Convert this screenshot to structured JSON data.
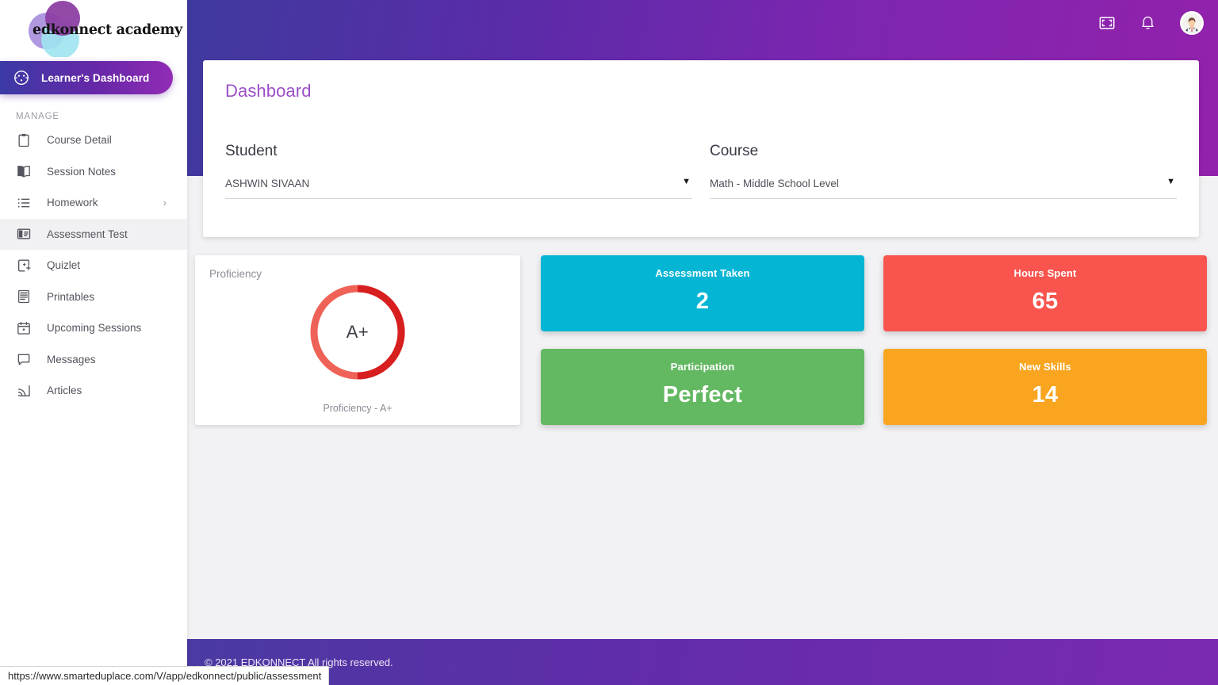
{
  "brand": {
    "name": "edkonnect academy",
    "logo_circle_colors": [
      "#8c3fa3",
      "#a88fdd",
      "#9fe4ef"
    ]
  },
  "sidebar": {
    "active_item": {
      "label": "Learner's Dashboard",
      "icon": "dashboard-icon"
    },
    "section_label": "MANAGE",
    "items": [
      {
        "label": "Course Detail",
        "icon": "clipboard-icon",
        "selected": false,
        "has_chevron": false
      },
      {
        "label": "Session Notes",
        "icon": "book-icon",
        "selected": false,
        "has_chevron": false
      },
      {
        "label": "Homework",
        "icon": "list-icon",
        "selected": false,
        "has_chevron": true
      },
      {
        "label": "Assessment Test",
        "icon": "test-icon",
        "selected": true,
        "has_chevron": false
      },
      {
        "label": "Quizlet",
        "icon": "quiz-add-icon",
        "selected": false,
        "has_chevron": false
      },
      {
        "label": "Printables",
        "icon": "printables-icon",
        "selected": false,
        "has_chevron": false
      },
      {
        "label": "Upcoming Sessions",
        "icon": "calendar-icon",
        "selected": false,
        "has_chevron": false
      },
      {
        "label": "Messages",
        "icon": "chat-icon",
        "selected": false,
        "has_chevron": false
      },
      {
        "label": "Articles",
        "icon": "rss-icon",
        "selected": false,
        "has_chevron": false
      }
    ]
  },
  "header": {
    "icons": [
      {
        "name": "fullscreen-icon"
      },
      {
        "name": "notification-bell-icon"
      },
      {
        "name": "user-avatar"
      }
    ]
  },
  "dashboard": {
    "title": "Dashboard",
    "student": {
      "label": "Student",
      "value": "ASHWIN SIVAAN",
      "caret": "▼"
    },
    "course": {
      "label": "Course",
      "value": "Math - Middle School Level",
      "caret": "▼"
    }
  },
  "proficiency": {
    "heading": "Proficiency",
    "center_value": "A+",
    "caption": "Proficiency - A+",
    "progress_percent": 50,
    "colors": {
      "progress": "#d71f1f",
      "track": "#ef6257"
    }
  },
  "stats": [
    {
      "title": "Assessment Taken",
      "value": "2",
      "color": "#05b5d4"
    },
    {
      "title": "Hours Spent",
      "value": "65",
      "color": "#f9544e"
    },
    {
      "title": "Participation",
      "value": "Perfect",
      "color": "#63b862"
    },
    {
      "title": "New Skills",
      "value": "14",
      "color": "#f9a520"
    }
  ],
  "footer": {
    "text": "© 2021 EDKONNECT All rights reserved."
  },
  "status_bar": {
    "url": "https://www.smarteduplace.com/V/app/edkonnect/public/assessment"
  },
  "theme": {
    "header_gradient_start": "#3f3a9e",
    "header_gradient_end": "#9321ab",
    "dashboard_title_color": "#9b4fc8",
    "page_background": "#f2f2f4"
  }
}
